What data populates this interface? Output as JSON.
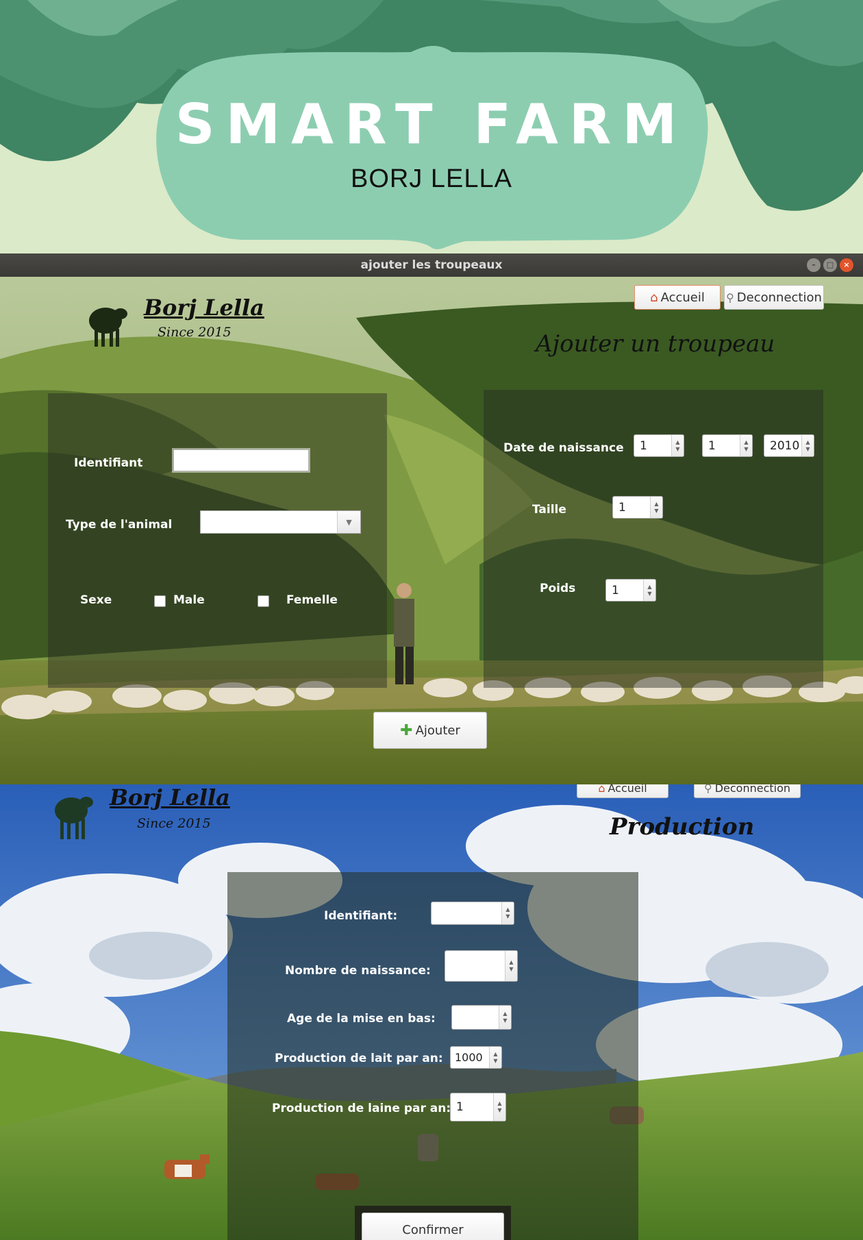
{
  "banner": {
    "title": "SMART FARM",
    "subtitle": "BORJ LELLA"
  },
  "window1": {
    "title": "ajouter les troupeaux",
    "controls": {
      "minimize": "–",
      "maximize": "□",
      "close": "×"
    },
    "logo": {
      "name": "Borj Lella",
      "since": "Since 2015"
    },
    "nav": {
      "home_label": "Accueil",
      "logout_label": "Deconnection"
    },
    "heading": "Ajouter un troupeau",
    "form": {
      "id_label": "Identifiant",
      "id_value": "",
      "type_label": "Type de l'animal",
      "type_value": "",
      "sex_label": "Sexe",
      "male_label": "Male",
      "female_label": "Femelle",
      "birth_label": "Date de naissance",
      "birth_day": "1",
      "birth_month": "1",
      "birth_year": "2010",
      "size_label": "Taille",
      "size_value": "1",
      "weight_label": "Poids",
      "weight_value": "1"
    },
    "add_label": "Ajouter",
    "icons": {
      "home": "home-icon",
      "logout": "key-icon",
      "add": "plus-icon",
      "logo": "sheep-icon"
    }
  },
  "window2": {
    "logo": {
      "name": "Borj Lella",
      "since": "Since 2015"
    },
    "nav": {
      "home_label": "Accueil",
      "logout_label": "Deconnection"
    },
    "heading": "Production",
    "form": {
      "id_label": "Identifiant:",
      "births_label": "Nombre de naissance:",
      "age_label": "Age de la mise en bas:",
      "milk_label": "Production de lait par an:",
      "milk_value": "1000",
      "wool_label": "Production de laine par an:",
      "wool_value": "1"
    },
    "confirm_label": "Confirmer"
  },
  "colors": {
    "banner_bg": "#dbeac8",
    "banner_dark": "#3f8463",
    "banner_mid": "#6aae8b",
    "banner_light": "#8ccdb0",
    "titlebar": "#3f3e3a",
    "panel": "#2a2c23"
  }
}
